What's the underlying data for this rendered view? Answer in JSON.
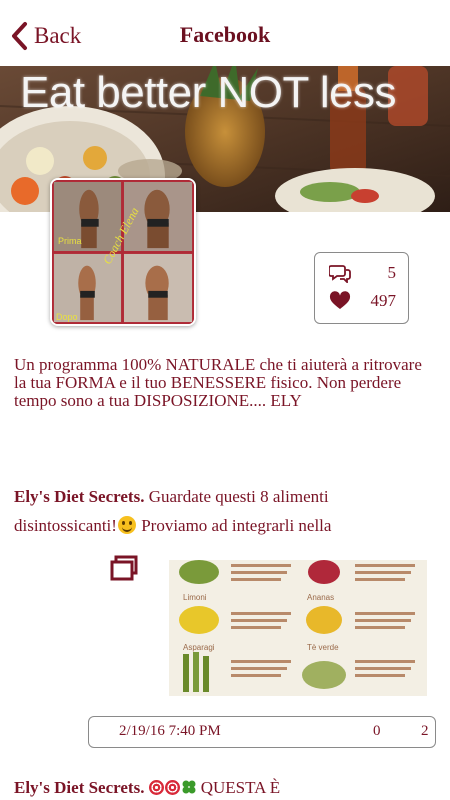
{
  "nav": {
    "back_label": "Back",
    "title": "Facebook"
  },
  "cover": {
    "headline": "Eat better NOT less"
  },
  "avatar": {
    "label_before": "Prima",
    "label_after": "Dopo",
    "signature": "Coach Elena"
  },
  "stats": {
    "comments_count": "5",
    "likes_count": "497",
    "comments_icon": "comments-icon",
    "likes_icon": "heart-icon"
  },
  "description": "Un programma 100% NATURALE che ti aiuterà a ritrovare la tua FORMA e il tuo BENESSERE fisico. Non perdere tempo sono a tua DISPOSIZIONE.... ELY",
  "post1": {
    "author": "Ely's Diet Secrets.",
    "text_before_emoji": " Guardate questi 8 alimenti disintossicanti!",
    "text_after_emoji": " Proviamo ad integrarli nella",
    "gallery_icon": "gallery-icon",
    "image_labels": {
      "limoni": "Limoni",
      "ananas": "Ananas",
      "asparagi": "Asparagi",
      "te_verde": "Tè verde"
    },
    "date": "2/19/16 7:40 PM",
    "comments": "0",
    "likes": "2"
  },
  "post2": {
    "author": "Ely's Diet Secrets.",
    "text": "QUESTA È"
  },
  "colors": {
    "accent": "#7a1426",
    "border": "#8a8a8a",
    "background": "#ffffff"
  }
}
